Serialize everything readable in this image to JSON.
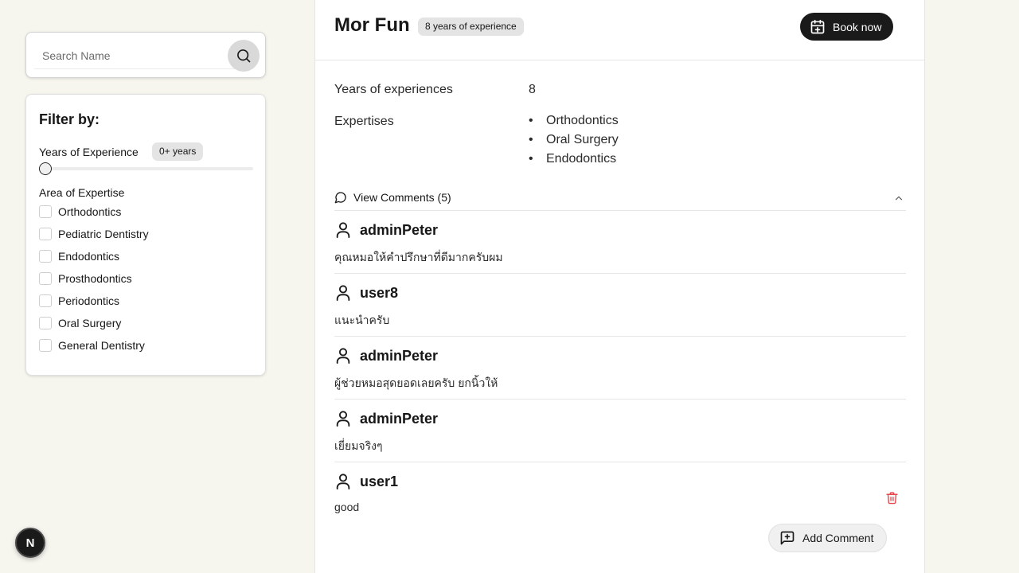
{
  "search": {
    "placeholder": "Search Name",
    "value": ""
  },
  "filter": {
    "title": "Filter by:",
    "experience_label": "Years of Experience",
    "experience_badge": "0+ years",
    "slider_value": 0,
    "area_label": "Area of Expertise",
    "areas": [
      {
        "label": "Orthodontics",
        "checked": false
      },
      {
        "label": "Pediatric Dentistry",
        "checked": false
      },
      {
        "label": "Endodontics",
        "checked": false
      },
      {
        "label": "Prosthodontics",
        "checked": false
      },
      {
        "label": "Periodontics",
        "checked": false
      },
      {
        "label": "Oral Surgery",
        "checked": false
      },
      {
        "label": "General Dentistry",
        "checked": false
      }
    ]
  },
  "fab": {
    "letter": "N"
  },
  "dentist": {
    "name": "Mor Fun",
    "experience_pill": "8 years of experience",
    "book_label": "Book now",
    "years_label": "Years of experiences",
    "years_value": "8",
    "expertises_label": "Expertises",
    "expertises": [
      "Orthodontics",
      "Oral Surgery",
      "Endodontics"
    ]
  },
  "comments": {
    "toggle_label": "View Comments (5)",
    "items": [
      {
        "user": "adminPeter",
        "text": "คุณหมอให้คำปรึกษาที่ดีมากครับผม"
      },
      {
        "user": "user8",
        "text": "แนะนำครับ"
      },
      {
        "user": "adminPeter",
        "text": "ผู้ช่วยหมอสุดยอดเลยครับ ยกนิ้วให้"
      },
      {
        "user": "adminPeter",
        "text": "เยี่ยมจริงๆ"
      },
      {
        "user": "user1",
        "text": "good"
      }
    ],
    "add_label": "Add Comment"
  },
  "colors": {
    "delete": "#e5484d",
    "dark_button": "#1a1a1a",
    "background": "#f6f5ee"
  },
  "icons": [
    "search-icon",
    "calendar-plus-icon",
    "message-circle-icon",
    "chevron-up-icon",
    "user-icon",
    "trash-icon",
    "message-square-plus-icon",
    "next-logo-icon"
  ]
}
